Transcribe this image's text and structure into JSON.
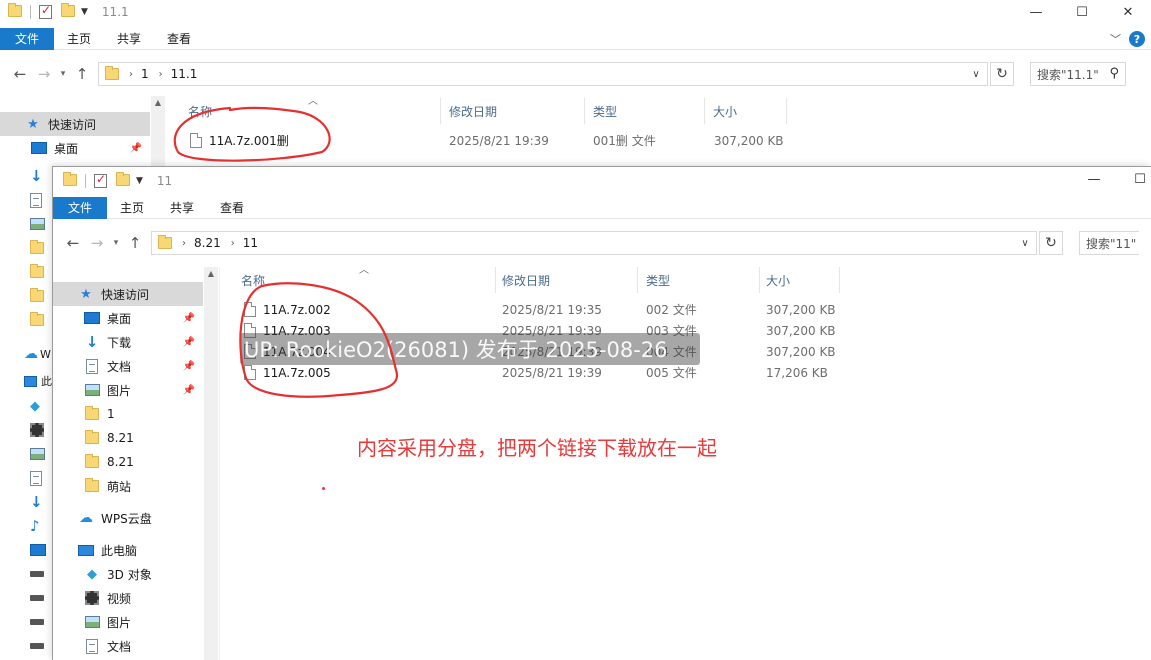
{
  "back_window": {
    "title": "11.1",
    "ribbon_tabs": [
      "文件",
      "主页",
      "共享",
      "查看"
    ],
    "breadcrumb": [
      "1",
      "11.1"
    ],
    "search_placeholder": "搜索\"11.1\"",
    "columns": {
      "name": "名称",
      "date": "修改日期",
      "type": "类型",
      "size": "大小"
    },
    "files": [
      {
        "name": "11A.7z.001删",
        "date": "2025/8/21 19:39",
        "type": "001删 文件",
        "size": "307,200 KB"
      }
    ],
    "sidebar": {
      "quick_access": "快速访问",
      "items": [
        {
          "label": "桌面",
          "icon": "desktop-icon"
        }
      ]
    }
  },
  "front_window": {
    "title": "11",
    "ribbon_tabs": [
      "文件",
      "主页",
      "共享",
      "查看"
    ],
    "breadcrumb": [
      "8.21",
      "11"
    ],
    "search_placeholder": "搜索\"11\"",
    "columns": {
      "name": "名称",
      "date": "修改日期",
      "type": "类型",
      "size": "大小"
    },
    "files": [
      {
        "name": "11A.7z.002",
        "date": "2025/8/21 19:35",
        "type": "002 文件",
        "size": "307,200 KB"
      },
      {
        "name": "11A.7z.003",
        "date": "2025/8/21 19:39",
        "type": "003 文件",
        "size": "307,200 KB"
      },
      {
        "name": "11A.7z.004",
        "date": "2025/8/21 19:39",
        "type": "004 文件",
        "size": "307,200 KB"
      },
      {
        "name": "11A.7z.005",
        "date": "2025/8/21 19:39",
        "type": "005 文件",
        "size": "17,206 KB"
      }
    ],
    "sidebar": {
      "quick_access": "快速访问",
      "items": [
        {
          "label": "桌面",
          "icon": "desktop-icon",
          "pinned": true
        },
        {
          "label": "下载",
          "icon": "download-icon",
          "pinned": true
        },
        {
          "label": "文档",
          "icon": "document-icon",
          "pinned": true
        },
        {
          "label": "图片",
          "icon": "picture-icon",
          "pinned": true
        },
        {
          "label": "1",
          "icon": "folder-icon"
        },
        {
          "label": "8.21",
          "icon": "folder-icon"
        },
        {
          "label": "8.21",
          "icon": "folder-icon"
        },
        {
          "label": "萌站",
          "icon": "folder-icon"
        }
      ],
      "wps_cloud": "WPS云盘",
      "this_pc": "此电脑",
      "pc_items": [
        {
          "label": "3D 对象",
          "icon": "3d-objects-icon"
        },
        {
          "label": "视频",
          "icon": "video-icon"
        },
        {
          "label": "图片",
          "icon": "picture-icon"
        },
        {
          "label": "文档",
          "icon": "document-icon"
        }
      ]
    }
  },
  "watermark": "UP: RookieO2(26081) 发布于 2025-08-26",
  "annotation": "内容采用分盘，把两个链接下载放在一起",
  "colors": {
    "accent": "#1979ca",
    "annotation_red": "#e83a3a",
    "selected_bg": "#d9d9d9"
  }
}
